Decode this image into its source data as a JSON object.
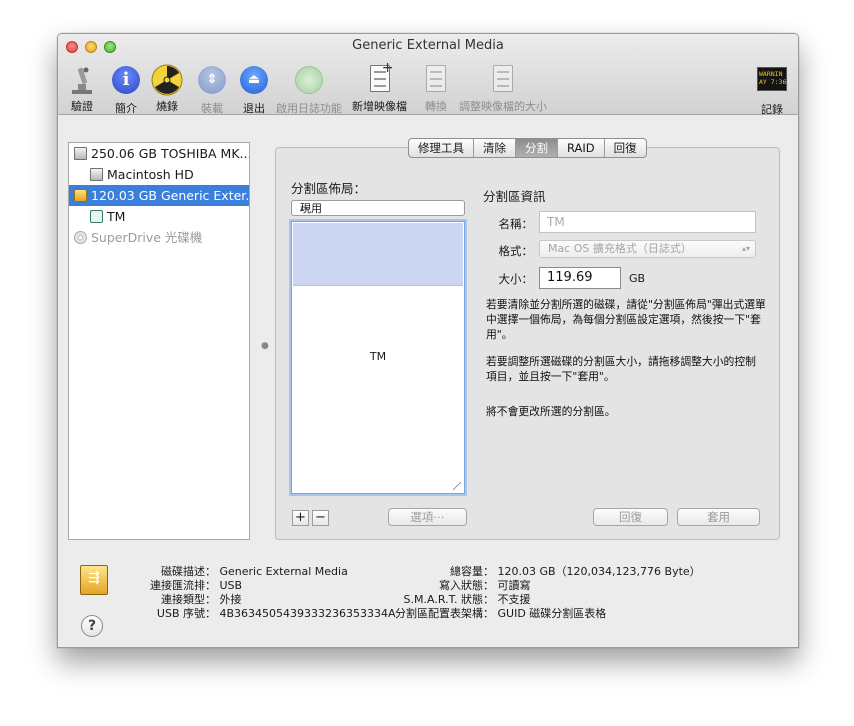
{
  "window": {
    "title": "Generic External Media"
  },
  "toolbar": {
    "items": [
      {
        "label": "驗證",
        "icon": "microscope-icon",
        "enabled": true
      },
      {
        "label": "簡介",
        "icon": "info-icon",
        "enabled": true
      },
      {
        "label": "燒錄",
        "icon": "burn-icon",
        "enabled": true
      },
      {
        "label": "裝載",
        "icon": "mount-icon",
        "enabled": false
      },
      {
        "label": "退出",
        "icon": "eject-icon",
        "enabled": true
      },
      {
        "label": "啟用日誌功能",
        "icon": "journal-icon",
        "enabled": false
      },
      {
        "label": "新增映像檔",
        "icon": "new-image-icon",
        "enabled": true
      },
      {
        "label": "轉換",
        "icon": "convert-icon",
        "enabled": false
      },
      {
        "label": "調整映像檔的大小",
        "icon": "resize-image-icon",
        "enabled": false
      }
    ],
    "log": {
      "label": "記錄",
      "icon_text": "WARNIN\nAY 7:36"
    }
  },
  "sidebar": {
    "items": [
      {
        "label": "250.06 GB TOSHIBA MK...",
        "icon": "hard-disk-icon",
        "level": 0,
        "selected": false,
        "disabled": false
      },
      {
        "label": "Macintosh HD",
        "icon": "volume-icon",
        "level": 1,
        "selected": false,
        "disabled": false
      },
      {
        "label": "120.03 GB Generic Exter...",
        "icon": "usb-drive-icon",
        "level": 0,
        "selected": true,
        "disabled": false
      },
      {
        "label": "TM",
        "icon": "time-machine-volume-icon",
        "level": 1,
        "selected": false,
        "disabled": false
      },
      {
        "label": "SuperDrive 光碟機",
        "icon": "optical-drive-icon",
        "level": 0,
        "selected": false,
        "disabled": true
      }
    ]
  },
  "tabs": [
    "修理工具",
    "清除",
    "分割",
    "RAID",
    "回復"
  ],
  "active_tab": "分割",
  "partition": {
    "layout_label": "分割區佈局：",
    "layout_value": "現用",
    "partition_name": "TM",
    "options_button": "選項⋯",
    "add": "+",
    "remove": "−"
  },
  "info": {
    "title": "分割區資訊",
    "name_label": "名稱：",
    "name_value": "TM",
    "format_label": "格式：",
    "format_value": "Mac OS 擴充格式（日誌式）",
    "size_label": "大小：",
    "size_value": "119.69",
    "size_unit": "GB",
    "help1": "若要清除並分割所選的磁碟，請從\"分割區佈局\"彈出式選單中選擇一個佈局，為每個分割區設定選項，然後按一下\"套用\"。",
    "help2": "若要調整所選磁碟的分割區大小，請拖移調整大小的控制項目，並且按一下\"套用\"。",
    "help3": "將不會更改所選的分割區。",
    "revert": "回復",
    "apply": "套用"
  },
  "details": {
    "left": [
      {
        "key": "磁碟描述：",
        "value": "Generic External Media"
      },
      {
        "key": "連接匯流排：",
        "value": "USB"
      },
      {
        "key": "連接類型：",
        "value": "外接"
      },
      {
        "key": "USB 序號：",
        "value": "4B3634505439333236353334A"
      }
    ],
    "right": [
      {
        "key": "總容量：",
        "value": "120.03 GB（120,034,123,776 Byte）"
      },
      {
        "key": "寫入狀態：",
        "value": "可讀寫"
      },
      {
        "key": "S.M.A.R.T. 狀態：",
        "value": "不支援"
      },
      {
        "key": "分割區配置表架構：",
        "value": "GUID 磁碟分割區表格"
      }
    ]
  },
  "help_button": "?",
  "colors": {
    "selection": "#3b7fdd",
    "free_space": "#ccd6f3"
  }
}
